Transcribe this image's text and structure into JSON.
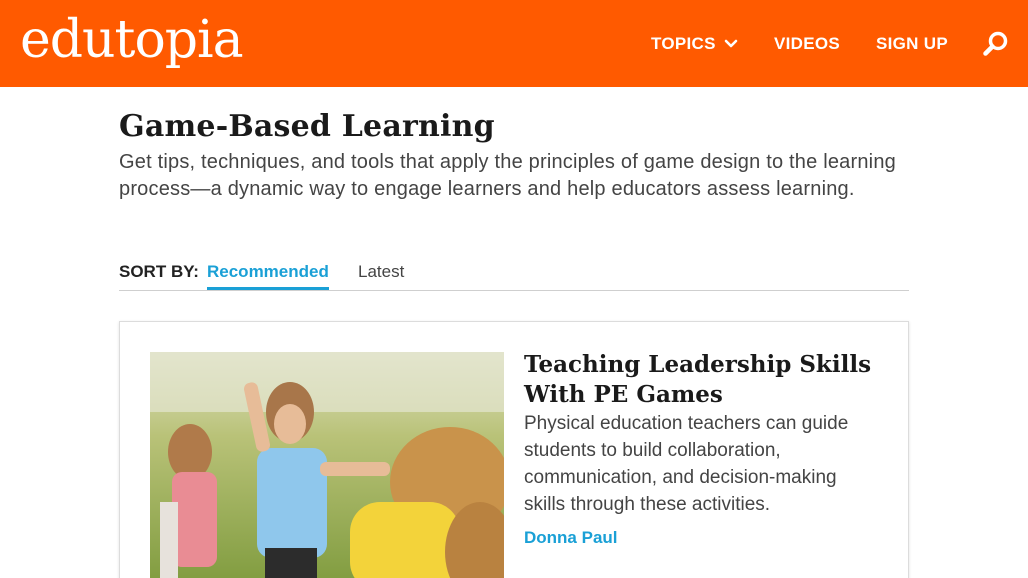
{
  "header": {
    "logo_text": "edutopia",
    "nav": {
      "topics": "TOPICS",
      "videos": "VIDEOS",
      "signup": "SIGN UP"
    },
    "brand_color": "#ff5a00",
    "search_icon": "search-icon"
  },
  "page": {
    "title": "Game-Based Learning",
    "description": "Get tips, techniques, and tools that apply the principles of game design to the learning process—a dynamic way to engage learners and help educators assess learning."
  },
  "sort": {
    "label": "SORT BY:",
    "options": [
      "Recommended",
      "Latest"
    ],
    "selected": "Recommended",
    "accent_color": "#1aa0d6"
  },
  "articles": [
    {
      "title": "Teaching Leadership Skills With PE Games",
      "description": "Physical education teachers can guide students to build collaboration, communication, and decision-making skills through these activities.",
      "author": "Donna Paul"
    }
  ]
}
